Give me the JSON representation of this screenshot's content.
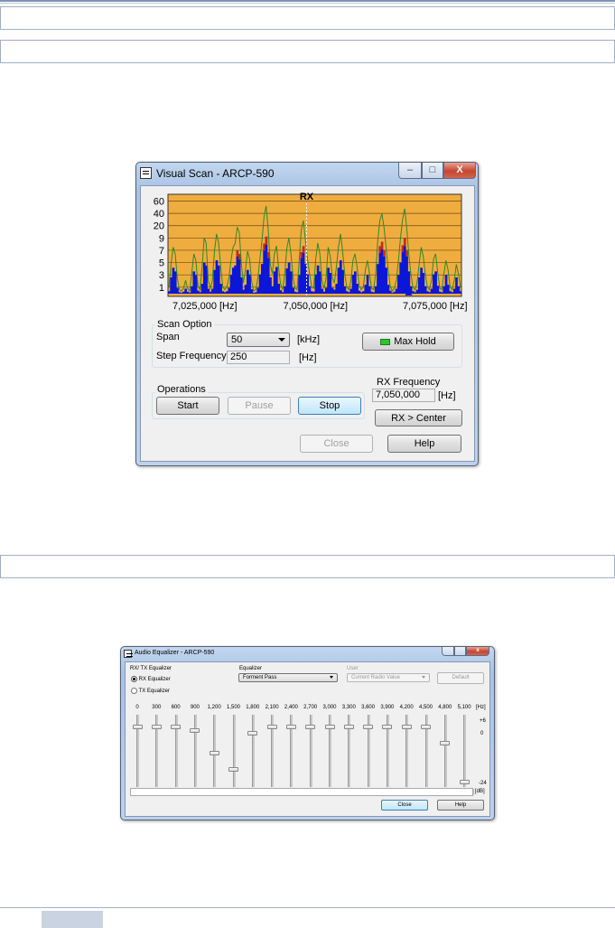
{
  "visual_scan": {
    "title": "Visual Scan - ARCP-590",
    "caption_buttons": {
      "minimize": "–",
      "maximize": "□",
      "close": "X"
    },
    "chart_data": {
      "type": "area",
      "title": "RX",
      "y_ticks": [
        "60",
        "40",
        "20",
        "9",
        "7",
        "5",
        "3",
        "1"
      ],
      "x_ticks": [
        "7,025,000 [Hz]",
        "7,050,000 [Hz]",
        "7,075,000 [Hz]"
      ],
      "xlim": [
        7025000,
        7075000
      ],
      "grid": true,
      "colors": {
        "background": "#f0ad3f",
        "signal": "#0b17d8",
        "peak": "#c8281c",
        "max_hold": "#2c8a2a",
        "marker": "#ffffff"
      },
      "series": [
        {
          "values": [
            0.5,
            2.2,
            3.5,
            3.0,
            1.2,
            0.3,
            0.2,
            0.4,
            1.0,
            0.4,
            0.2,
            1.5,
            3.0,
            2.5,
            0.6,
            0.3,
            2.0,
            4.2,
            3.8,
            1.0,
            0.4,
            1.0,
            3.2,
            4.5,
            3.8,
            2.0,
            0.5,
            0.3,
            0.5,
            1.2,
            2.5,
            3.5,
            3.8,
            5.0,
            4.6,
            2.2,
            0.8,
            1.8,
            3.2,
            2.6,
            0.9,
            0.2,
            0.3,
            1.2,
            2.6,
            4.0,
            5.8,
            6.6,
            4.8,
            2.2,
            1.5,
            3.0,
            3.6,
            2.0,
            0.7,
            0.3,
            1.5,
            3.4,
            4.2,
            3.0,
            1.2,
            0.4,
            0.3,
            2.5,
            4.8,
            5.5,
            4.0,
            2.6,
            1.5,
            0.5,
            0.4,
            2.6,
            3.8,
            3.0,
            1.0,
            0.4,
            1.2,
            3.5,
            2.8,
            1.2,
            0.8,
            2.0,
            3.5,
            4.5,
            3.2,
            1.5,
            0.5,
            0.3,
            1.0,
            2.5,
            3.0,
            2.0,
            0.6,
            0.3,
            0.5,
            1.8,
            2.5,
            1.5,
            0.4,
            0.3,
            1.5,
            4.0,
            5.5,
            6.0,
            5.0,
            3.5,
            1.8,
            0.6,
            0.2,
            0.4,
            1.0,
            2.5,
            4.2,
            5.6,
            6.4,
            5.0,
            3.0,
            1.5,
            0.5,
            0.3,
            0.8,
            2.2,
            3.5,
            2.8,
            1.5,
            0.5,
            0.3,
            1.0,
            2.6,
            3.0,
            1.6,
            0.4,
            0.3,
            1.5,
            2.5,
            1.8,
            0.5,
            0.3,
            1.0,
            2.2,
            1.5,
            0.5
          ]
        }
      ]
    },
    "scan_option": {
      "caption": "Scan Option",
      "span_label": "Span",
      "span_value": "50",
      "span_unit": "[kHz]",
      "step_label": "Step Frequency",
      "step_value": "250",
      "step_unit": "[Hz]",
      "max_hold_label": "Max Hold"
    },
    "operations": {
      "caption": "Operations",
      "start": "Start",
      "pause": "Pause",
      "stop": "Stop"
    },
    "rx_frequency": {
      "label": "RX Frequency",
      "value": "7,050,000",
      "unit": "[Hz]",
      "center_button": "RX > Center"
    },
    "close": "Close",
    "help": "Help"
  },
  "audio_equalizer": {
    "title": "Audio Equalizer - ARCP-590",
    "rx_tx_caption": "RX/ TX Equalizer",
    "rx_option": "RX Equalizer",
    "tx_option": "TX Equalizer",
    "equalizer_label": "Equalizer",
    "equalizer_value": "Forment Pass",
    "user_label": "User",
    "user_value": "Current Radio Value",
    "default_button": "Default",
    "hz_unit": "[Hz]",
    "db_unit": "[dB]",
    "scale_top": "+6",
    "scale_mid": "0",
    "scale_bottom": "-24",
    "bands": [
      {
        "freq": "0",
        "value": "3",
        "level": 3
      },
      {
        "freq": "300",
        "value": "3",
        "level": 3
      },
      {
        "freq": "600",
        "value": "3",
        "level": 3
      },
      {
        "freq": "900",
        "value": "1",
        "level": 1
      },
      {
        "freq": "1,200",
        "value": "-10",
        "level": -10
      },
      {
        "freq": "1,500",
        "value": "-18",
        "level": -18
      },
      {
        "freq": "1,800",
        "value": "0",
        "level": 0
      },
      {
        "freq": "2,100",
        "value": "3",
        "level": 3
      },
      {
        "freq": "2,400",
        "value": "3",
        "level": 3
      },
      {
        "freq": "2,700",
        "value": "3",
        "level": 3
      },
      {
        "freq": "3,000",
        "value": "3",
        "level": 3
      },
      {
        "freq": "3,300",
        "value": "3",
        "level": 3
      },
      {
        "freq": "3,600",
        "value": "3",
        "level": 3
      },
      {
        "freq": "3,900",
        "value": "3",
        "level": 3
      },
      {
        "freq": "4,200",
        "value": "3",
        "level": 3
      },
      {
        "freq": "4,500",
        "value": "3",
        "level": 3
      },
      {
        "freq": "4,800",
        "value": "-5",
        "level": -5
      },
      {
        "freq": "5,100",
        "value": "-24",
        "level": -24
      }
    ],
    "close": "Close",
    "help": "Help"
  }
}
